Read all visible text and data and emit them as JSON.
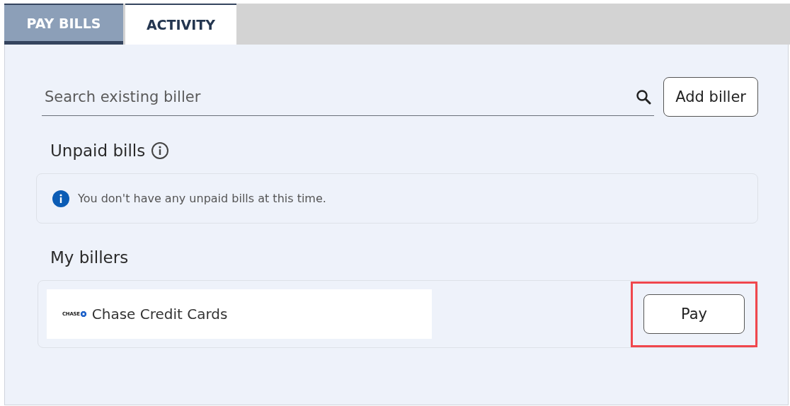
{
  "tabs": [
    {
      "label": "PAY BILLS",
      "selected": true
    },
    {
      "label": "ACTIVITY",
      "selected": false
    }
  ],
  "search": {
    "placeholder": "Search existing biller"
  },
  "add_button": "Add biller",
  "unpaid": {
    "title": "Unpaid bills",
    "message": "You don't have any unpaid bills at this time."
  },
  "billers": {
    "title": "My billers",
    "items": [
      {
        "logo": "CHASE",
        "name": "Chase Credit Cards",
        "button": "Pay",
        "highlighted": true
      }
    ]
  }
}
